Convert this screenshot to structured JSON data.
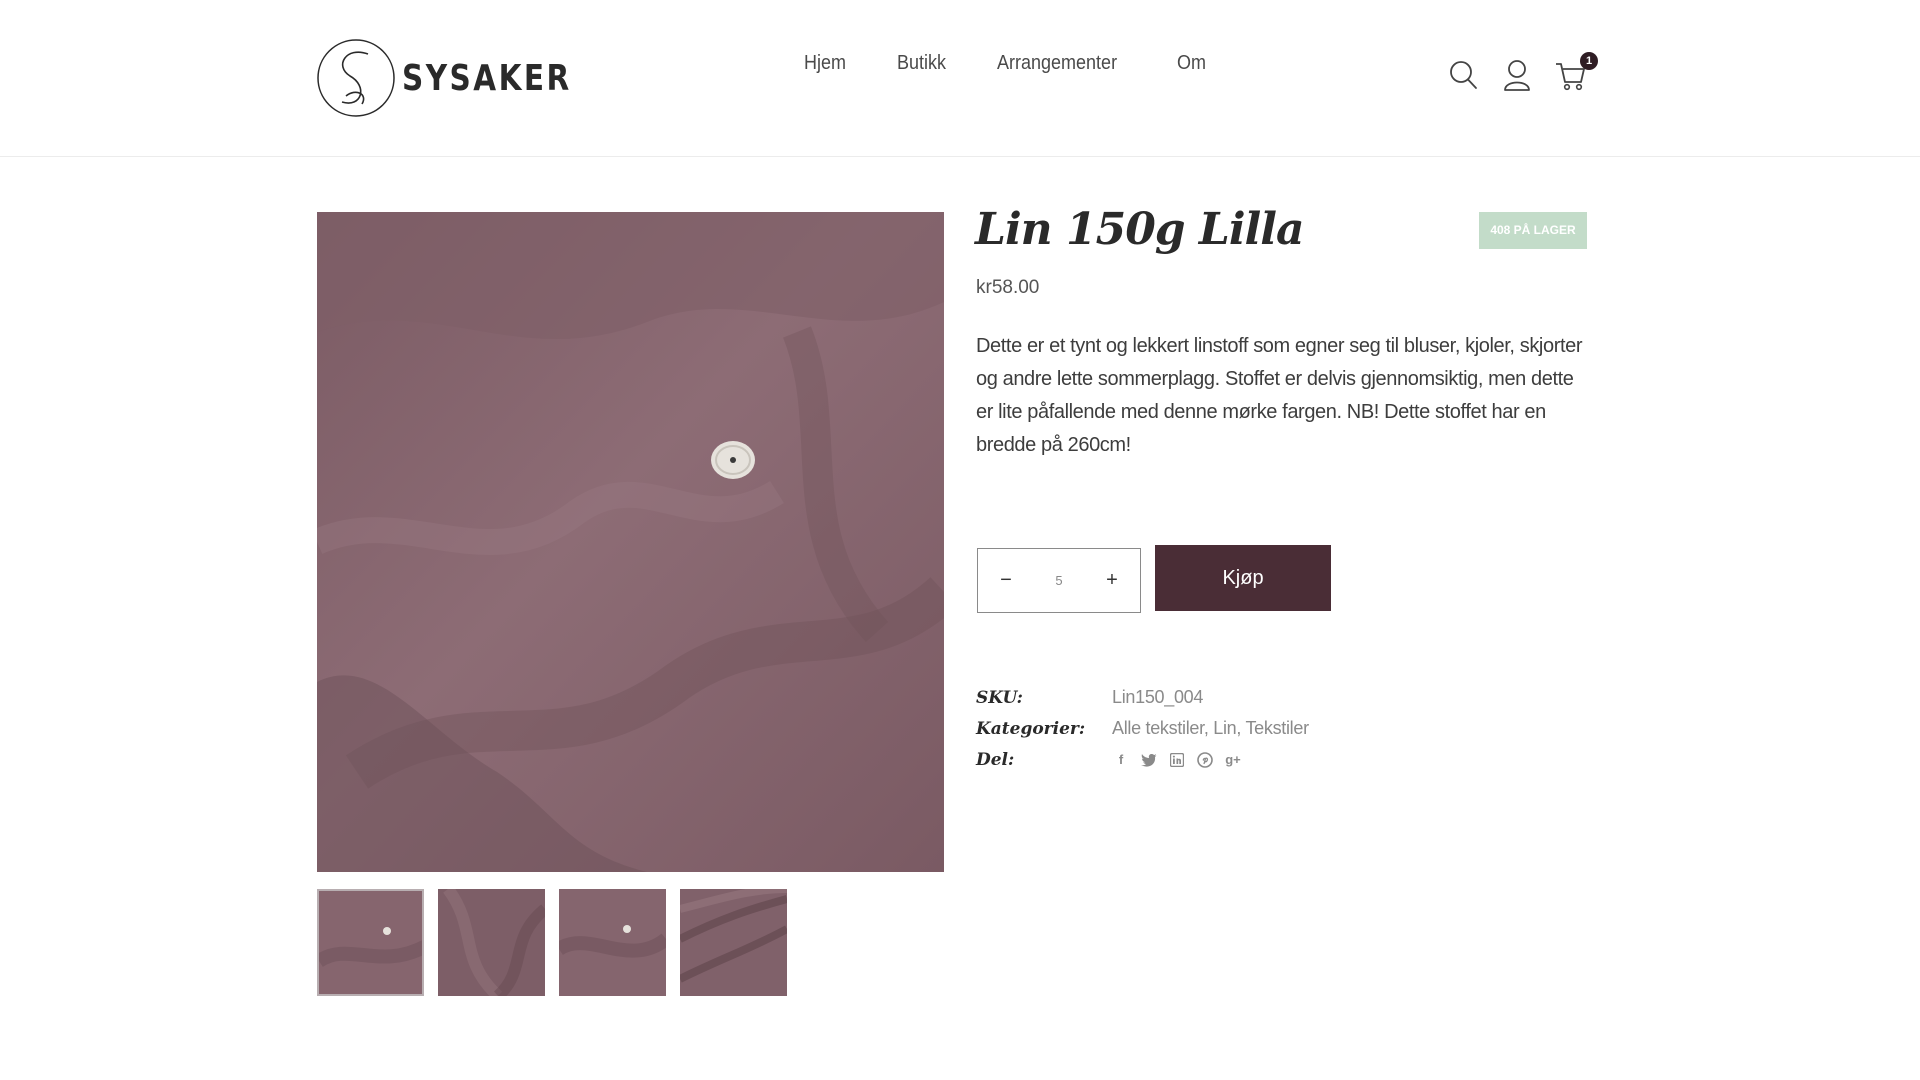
{
  "brand": {
    "name": "SYSAKER",
    "logo_letter": "S"
  },
  "nav": [
    {
      "label": "Hjem"
    },
    {
      "label": "Butikk"
    },
    {
      "label": "Arrangementer"
    },
    {
      "label": "Om"
    }
  ],
  "header_icons": {
    "search": "search-icon",
    "account": "user-icon",
    "cart": "cart-icon",
    "cart_count": "1"
  },
  "product": {
    "title": "Lin 150g Lilla",
    "stock_badge": "408 PÅ LAGER",
    "price_currency": "kr",
    "price_value": "58.00",
    "description": "Dette er et tynt og lekkert linstoff som egner seg til bluser, kjoler, skjorter og andre lette sommerplagg. Stoffet er delvis gjennomsiktig, men dette er lite påfallende med denne mørke fargen. NB! Dette stoffet har en bredde på 260cm!",
    "quantity": "5",
    "qty_minus": "−",
    "qty_plus": "+",
    "buy_label": "Kjøp"
  },
  "meta": {
    "sku_label": "SKU:",
    "sku_value": "Lin150_004",
    "categories_label": "Kategorier:",
    "categories": [
      "Alle tekstiler",
      "Lin",
      "Tekstiler"
    ],
    "share_label": "Del:",
    "share_icons": [
      "facebook-icon",
      "twitter-icon",
      "linkedin-icon",
      "pinterest-icon",
      "google-plus-icon"
    ],
    "share_glyphs": [
      "f",
      "t",
      "in",
      "p",
      "g+"
    ]
  },
  "colors": {
    "fabric": "#85656e",
    "buy_button": "#4a2d36",
    "stock_badge": "#c3dcc9",
    "badge": "#2f1d24"
  }
}
